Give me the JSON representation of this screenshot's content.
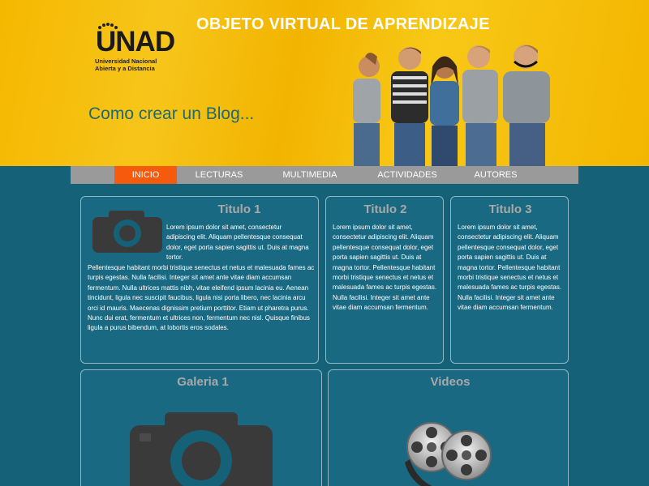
{
  "header": {
    "title": "OBJETO VIRTUAL DE APRENDIZAJE",
    "logo_word": "UNAD",
    "logo_line1": "Universidad Nacional",
    "logo_line2": "Abierta y a Distancia",
    "tagline": "Como crear un Blog..."
  },
  "nav": {
    "items": [
      {
        "label": "INICIO",
        "active": true
      },
      {
        "label": "LECTURAS",
        "active": false
      },
      {
        "label": "MULTIMEDIA",
        "active": false
      },
      {
        "label": "ACTIVIDADES",
        "active": false
      },
      {
        "label": "AUTORES",
        "active": false
      }
    ]
  },
  "panels": {
    "titulo1": {
      "title": "Titulo 1",
      "text_beside_icon": "Lorem ipsum dolor sit amet, consectetur adipiscing elit. Aliquam pellentesque consequat dolor, eget porta sapien sagittis ut. Duis at magna tortor.",
      "text_below": "Pellentesque habitant morbi tristique senectus et netus et malesuada fames ac turpis egestas. Nulla facilisi. Integer sit amet ante vitae diam accumsan fermentum. Nulla ultrices mattis nibh, vitae eleifend ipsum lacinia eu. Aenean tincidunt, ligula nec suscipit faucibus, ligula nisi porta libero, nec lacinia arcu orci id mauris. Maecenas dignissim pretium porttitor. Etiam ut pharetra purus. Nunc dui erat, fermentum et ultrices non, fermentum nec nisl. Quisque finibus ligula a purus bibendum, at lobortis eros sodales."
    },
    "titulo2": {
      "title": "Titulo 2",
      "text": "Lorem ipsum dolor sit amet, consectetur adipiscing elit. Aliquam pellentesque consequat dolor, eget porta sapien sagittis ut. Duis at magna tortor. Pellentesque habitant morbi tristique senectus et netus et malesuada fames ac turpis egestas. Nulla facilisi. Integer sit amet ante vitae diam accumsan fermentum."
    },
    "titulo3": {
      "title": "Titulo 3",
      "text": "Lorem ipsum dolor sit amet, consectetur adipiscing elit. Aliquam pellentesque consequat dolor, eget porta sapien sagittis ut. Duis at magna tortor. Pellentesque habitant morbi tristique senectus et netus et malesuada fames ac turpis egestas. Nulla facilisi. Integer sit amet ante vitae diam accumsan fermentum."
    },
    "galeria": {
      "title": "Galeria 1"
    },
    "videos": {
      "title": "Videos"
    }
  },
  "colors": {
    "background": "#156178",
    "header_yellow": "#f5b800",
    "nav_gray": "#9a9a9a",
    "nav_active": "#f55a0d",
    "panel_title": "#a9a9a9",
    "icon_dark": "#3a3a3a"
  }
}
